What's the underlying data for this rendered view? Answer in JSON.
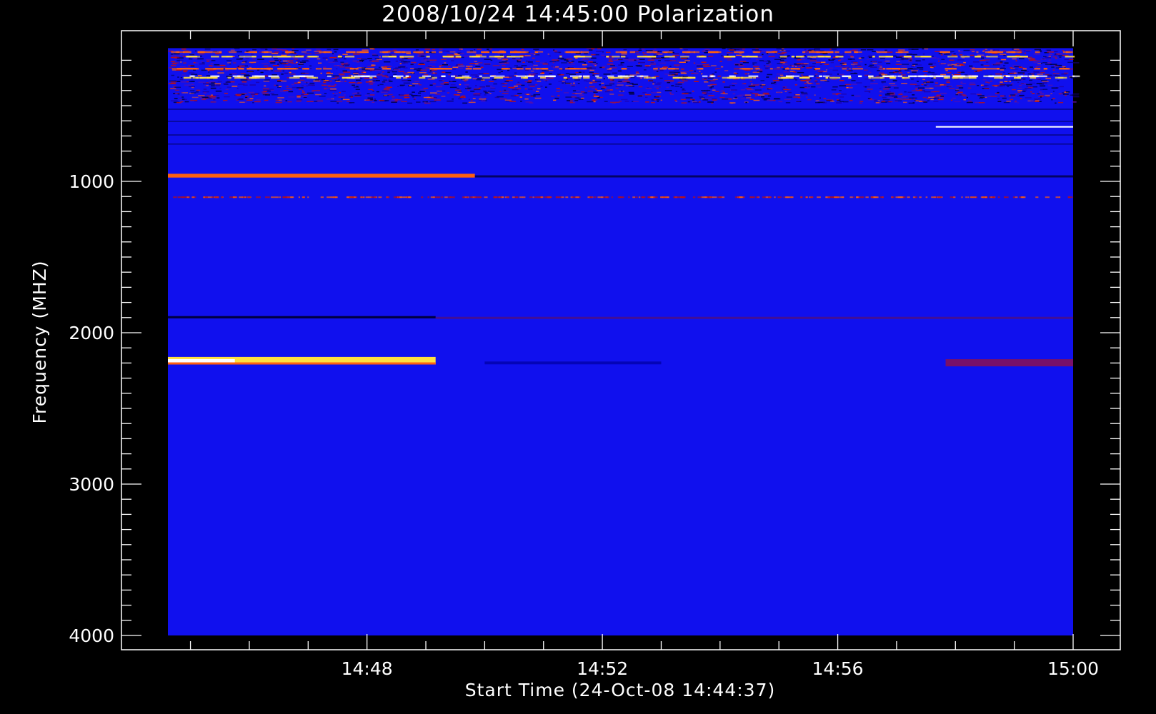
{
  "chart_data": {
    "type": "heatmap",
    "title": "2008/10/24 14:45:00 Polarization",
    "xlabel": "Start Time (24-Oct-08 14:44:37)",
    "ylabel": "Frequency (MHZ)",
    "x_start": "14:44:37",
    "x_end": "15:00:00",
    "x_ticks": [
      "14:48",
      "14:52",
      "14:56",
      "15:00"
    ],
    "y_ticks": [
      1000,
      2000,
      3000,
      4000
    ],
    "y_range": [
      120,
      4000
    ],
    "y_inverted": true,
    "colors": {
      "background": "#1010ee",
      "dark": "#000040",
      "red": "#c01010",
      "orange": "#ff6010",
      "yellow": "#ffe040",
      "white": "#ffffff"
    },
    "features": [
      {
        "name": "hot band 2160-2210 MHz",
        "freq": [
          2160,
          2210
        ],
        "time": [
          "14:44:37",
          "14:49:10"
        ],
        "level": "yellow-white"
      },
      {
        "name": "red band 960 MHz",
        "freq": [
          950,
          975
        ],
        "time": [
          "14:44:37",
          "14:49:50"
        ],
        "level": "red-orange"
      },
      {
        "name": "dark band 1900 MHz",
        "freq": [
          1890,
          1905
        ],
        "time": [
          "14:44:37",
          "14:49:10"
        ],
        "level": "dark"
      },
      {
        "name": "bright line 640 MHz",
        "freq": [
          635,
          645
        ],
        "time": [
          "14:57:40",
          "15:00:00"
        ],
        "level": "white"
      },
      {
        "name": "noisy band 120-480 MHz",
        "freq": [
          120,
          480
        ],
        "time": [
          "14:44:37",
          "15:00:00"
        ],
        "level": "mixed"
      }
    ]
  }
}
